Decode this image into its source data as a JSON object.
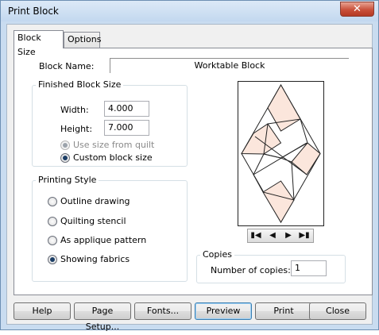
{
  "window": {
    "title": "Print Block",
    "close_glyph": "✕"
  },
  "tabs": [
    {
      "label": "Block Size",
      "active": true
    },
    {
      "label": "Options",
      "active": false
    }
  ],
  "block_name": {
    "label": "Block Name:",
    "value": "Worktable Block"
  },
  "finished_block_size": {
    "legend": "Finished Block Size",
    "width_label": "Width:",
    "width_value": "4.000",
    "height_label": "Height:",
    "height_value": "7.000",
    "use_size_from_quilt": "Use size from quilt",
    "custom_block_size": "Custom block size"
  },
  "printing_style": {
    "legend": "Printing Style",
    "options": [
      "Outline drawing",
      "Quilting stencil",
      "As applique pattern",
      "Showing fabrics"
    ],
    "selected": 3
  },
  "preview_nav": {
    "first": "first-icon",
    "prev": "prev-icon",
    "next": "next-icon",
    "last": "last-icon"
  },
  "copies": {
    "legend": "Copies",
    "label": "Number of copies:",
    "value": "1"
  },
  "buttons": {
    "help": "Help",
    "page_setup": "Page Setup...",
    "fonts": "Fonts...",
    "preview": "Preview",
    "print": "Print",
    "close": "Close"
  },
  "colors": {
    "fabric_peach": "#fbe6dc",
    "fabric_white": "#ffffff",
    "outline": "#222222"
  }
}
